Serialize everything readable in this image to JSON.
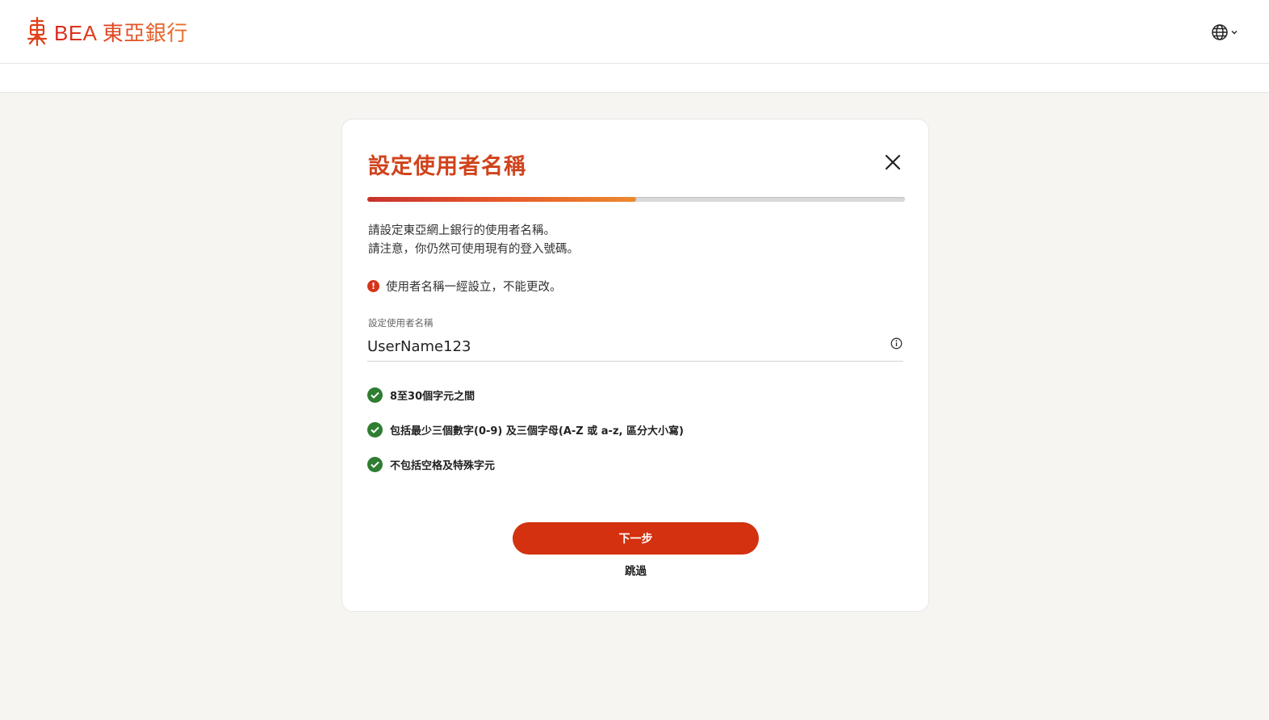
{
  "header": {
    "brand_name": "BEA 東亞銀行",
    "logo_icon": "bea-logo-icon",
    "language_icon": "globe-icon"
  },
  "dialog": {
    "title": "設定使用者名稱",
    "progress": 0.5,
    "intro_line1": "請設定東亞網上銀行的使用者名稱。",
    "intro_line2": "請注意，你仍然可使用現有的登入號碼。",
    "warning": "使用者名稱一經設立，不能更改。",
    "field_label": "設定使用者名稱",
    "field_value": "UserName123",
    "rules": [
      {
        "text": "8至30個字元之間",
        "status": "passed"
      },
      {
        "text": "包括最少三個數字(0-9) 及三個字母(A-Z 或 a-z, 區分大小寫)",
        "status": "passed"
      },
      {
        "text": "不包括空格及特殊字元",
        "status": "passed"
      }
    ],
    "next_label": "下一步",
    "skip_label": "跳過"
  },
  "colors": {
    "accent": "#d3310f",
    "title": "#d0431c",
    "success": "#2e7d32"
  }
}
